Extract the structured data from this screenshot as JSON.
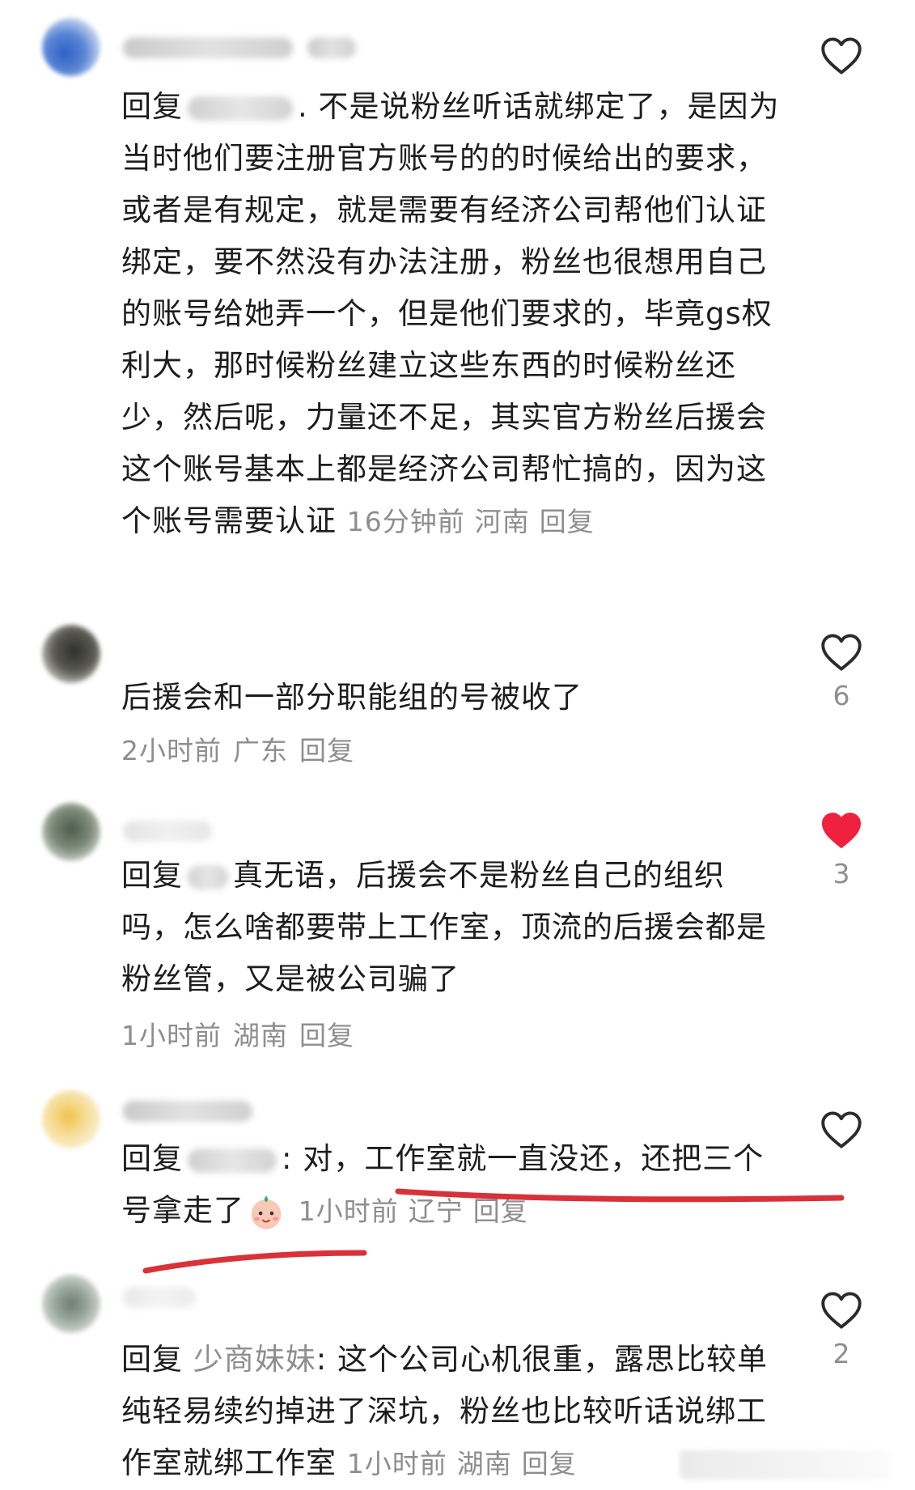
{
  "comments": [
    {
      "reply_prefix": "回复",
      "text_after_name": ". 不是说粉丝听话就绑定了，是因为当时他们要注册官方账号的的时候给出的要求，或者是有规定，就是需要有经济公司帮他们认证绑定，要不然没有办法注册，粉丝也很想用自己的账号给她弄一个，但是他们要求的，毕竟gs权利大，那时候粉丝建立这些东西的时候粉丝还少，然后呢，力量还不足，其实官方粉丝后援会这个账号基本上都是经济公司帮忙搞的，因为这个账号需要认证",
      "time": "16分钟前",
      "location": "河南",
      "reply_label": "回复",
      "liked": false,
      "like_count": ""
    },
    {
      "text": "后援会和一部分职能组的号被收了",
      "time": "2小时前",
      "location": "广东",
      "reply_label": "回复",
      "liked": false,
      "like_count": "6"
    },
    {
      "reply_prefix": "回复",
      "text_after_name": "真无语，后援会不是粉丝自己的组织吗，怎么啥都要带上工作室，顶流的后援会都是粉丝管，又是被公司骗了",
      "time": "1小时前",
      "location": "湖南",
      "reply_label": "回复",
      "liked": true,
      "like_count": "3"
    },
    {
      "reply_prefix": "回复",
      "text_after_name": ": 对，工作室就一直没还，还把三个号拿走了",
      "time": "1小时前",
      "location": "辽宁",
      "reply_label": "回复",
      "liked": false,
      "like_count": ""
    },
    {
      "reply_prefix": "回复",
      "reply_name": "少商妹妹",
      "text_after_name": ": 这个公司心机很重，露思比较单纯轻易续约掉进了深坑，粉丝也比较听话说绑工作室就绑工作室",
      "time": "1小时前",
      "location": "湖南",
      "reply_label": "回复",
      "liked": false,
      "like_count": "2"
    }
  ],
  "colors": {
    "text": "#1d1d1d",
    "meta": "#8e8e8e",
    "heart_outline": "#2b2b2b",
    "heart_liked": "#f0213f",
    "annotation_underline": "#d9313a"
  },
  "icons": {
    "like": "heart-outline-icon",
    "liked": "heart-filled-icon",
    "emoji": "baby-face-emoji-icon"
  }
}
